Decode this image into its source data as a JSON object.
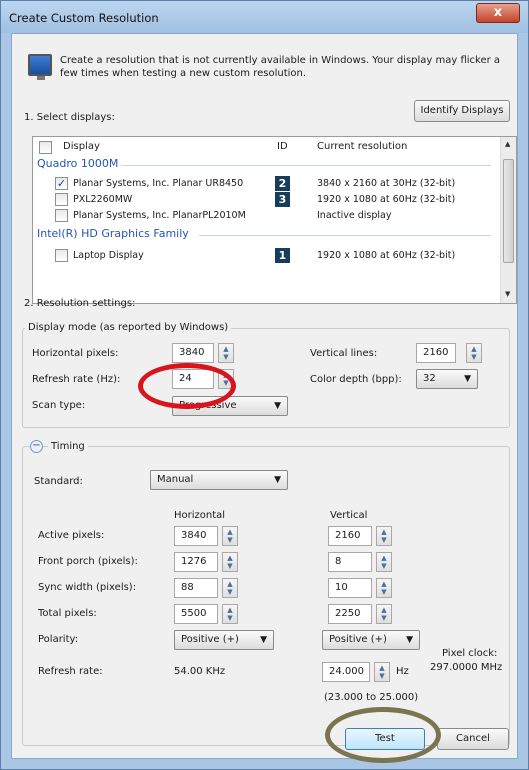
{
  "window": {
    "title": "Create Custom Resolution",
    "close_label": "x"
  },
  "intro": "Create a resolution that is not currently available in Windows. Your display may flicker a few times when testing a new custom resolution.",
  "section1": {
    "label": "1. Select displays:",
    "identify_button": "Identify Displays"
  },
  "list": {
    "headers": {
      "display": "Display",
      "id": "ID",
      "current": "Current resolution"
    },
    "groups": [
      {
        "name": "Quadro 1000M",
        "rows": [
          {
            "name": "Planar Systems, Inc. Planar UR8450",
            "id": "2",
            "res": "3840 x 2160 at 30Hz (32-bit)",
            "checked": true
          },
          {
            "name": "PXL2260MW",
            "id": "3",
            "res": "1920 x 1080 at 60Hz (32-bit)",
            "checked": false
          },
          {
            "name": "Planar Systems, Inc. PlanarPL2010M",
            "id": "",
            "res": "Inactive display",
            "checked": false
          }
        ]
      },
      {
        "name": "Intel(R) HD Graphics Family",
        "rows": [
          {
            "name": "Laptop Display",
            "id": "1",
            "res": "1920 x 1080 at 60Hz (32-bit)",
            "checked": false
          }
        ]
      }
    ]
  },
  "section2": {
    "label": "2. Resolution settings:"
  },
  "mode": {
    "group_label": "Display mode (as reported by Windows)",
    "h_pixels": {
      "label": "Horizontal pixels:",
      "value": "3840"
    },
    "v_lines": {
      "label": "Vertical lines:",
      "value": "2160"
    },
    "refresh": {
      "label": "Refresh rate (Hz):",
      "value": "24"
    },
    "color_depth": {
      "label": "Color depth (bpp):",
      "value": "32"
    },
    "scan": {
      "label": "Scan type:",
      "value": "Progressive"
    }
  },
  "timing": {
    "label": "Timing",
    "standard": {
      "label": "Standard:",
      "value": "Manual"
    },
    "col_h": "Horizontal",
    "col_v": "Vertical",
    "active": {
      "label": "Active pixels:",
      "h": "3840",
      "v": "2160"
    },
    "front": {
      "label": "Front porch (pixels):",
      "h": "1276",
      "v": "8"
    },
    "sync": {
      "label": "Sync width (pixels):",
      "h": "88",
      "v": "10"
    },
    "total": {
      "label": "Total pixels:",
      "h": "5500",
      "v": "2250"
    },
    "polarity": {
      "label": "Polarity:",
      "h": "Positive (+)",
      "v": "Positive (+)"
    },
    "refresh": {
      "label": "Refresh rate:",
      "h": "54.00 KHz",
      "v": "24.000",
      "unit": "Hz",
      "range": "(23.000 to 25.000)"
    },
    "pixel_clock": {
      "label": "Pixel clock:",
      "value": "297.0000 MHz"
    }
  },
  "buttons": {
    "test": "Test",
    "cancel": "Cancel"
  }
}
